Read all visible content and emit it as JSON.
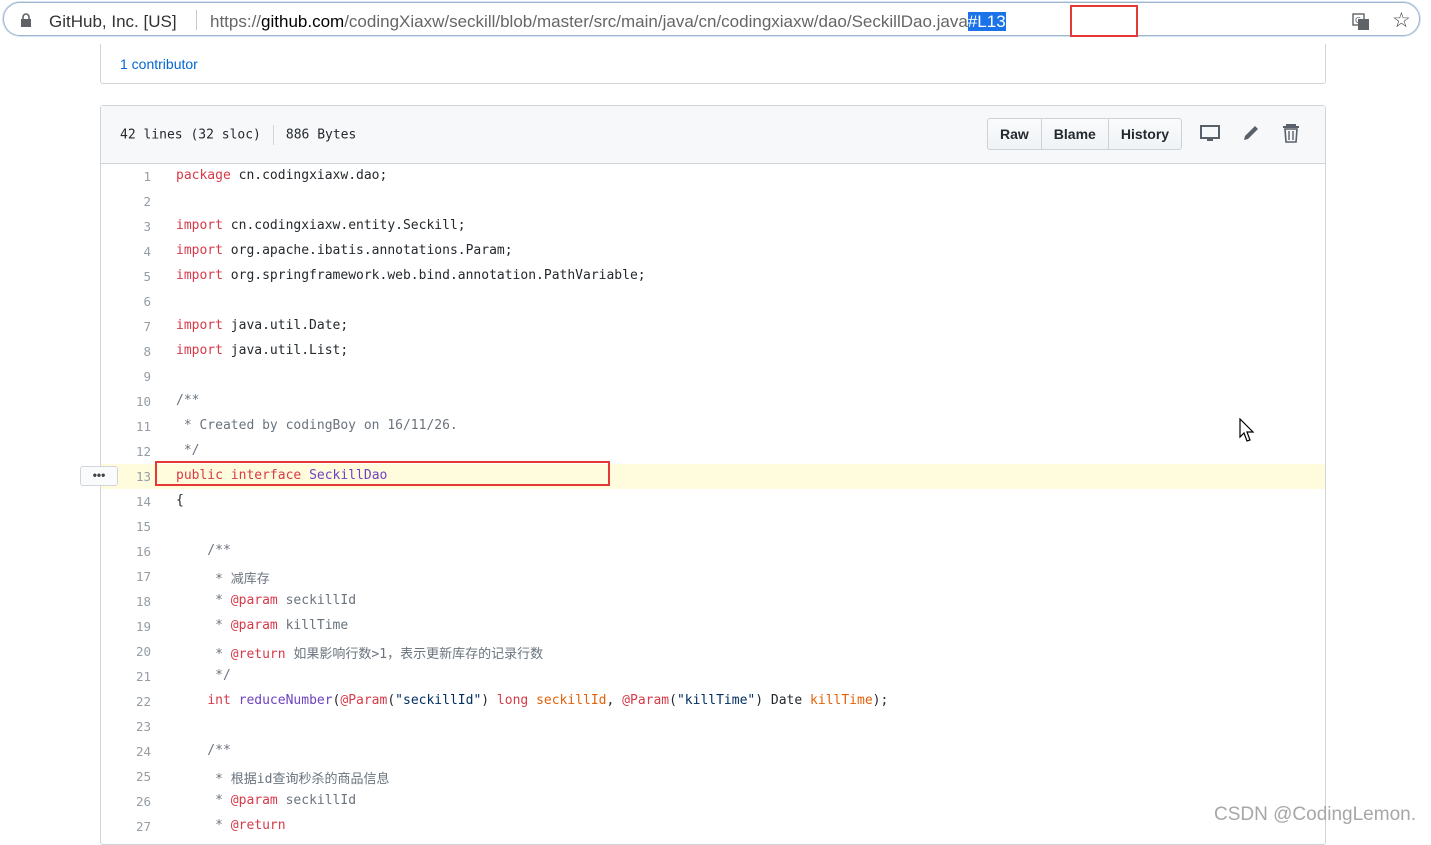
{
  "address_bar": {
    "site_identity": "GitHub, Inc. [US]",
    "url_prefix": "https://",
    "url_host": "github.com",
    "url_path": "/codingXiaxw/seckill/blob/master/src/main/java/cn/codingxiaxw/dao/SeckillDao.java",
    "url_hash": "#L13",
    "lock_icon": "lock-icon",
    "translate_icon": "translate-icon",
    "bookmark_icon": "star-icon"
  },
  "contributors": {
    "link": "1 contributor"
  },
  "file_header": {
    "lines_info": "42 lines (32 sloc)",
    "size": "886 Bytes",
    "buttons": {
      "raw": "Raw",
      "blame": "Blame",
      "history": "History"
    },
    "icons": [
      "desktop-icon",
      "pencil-icon",
      "trash-icon"
    ]
  },
  "highlighted_line": 13,
  "code_lines": [
    {
      "n": "1",
      "tokens": [
        {
          "t": "package",
          "c": "k"
        },
        {
          "t": " cn.codingxiaxw.dao;",
          "c": ""
        }
      ]
    },
    {
      "n": "2",
      "tokens": []
    },
    {
      "n": "3",
      "tokens": [
        {
          "t": "import",
          "c": "k"
        },
        {
          "t": " cn.codingxiaxw.entity.Seckill;",
          "c": ""
        }
      ]
    },
    {
      "n": "4",
      "tokens": [
        {
          "t": "import",
          "c": "k"
        },
        {
          "t": " org.apache.ibatis.annotations.Param;",
          "c": ""
        }
      ]
    },
    {
      "n": "5",
      "tokens": [
        {
          "t": "import",
          "c": "k"
        },
        {
          "t": " org.springframework.web.bind.annotation.PathVariable;",
          "c": ""
        }
      ]
    },
    {
      "n": "6",
      "tokens": []
    },
    {
      "n": "7",
      "tokens": [
        {
          "t": "import",
          "c": "k"
        },
        {
          "t": " java.util.Date;",
          "c": ""
        }
      ]
    },
    {
      "n": "8",
      "tokens": [
        {
          "t": "import",
          "c": "k"
        },
        {
          "t": " java.util.List;",
          "c": ""
        }
      ]
    },
    {
      "n": "9",
      "tokens": []
    },
    {
      "n": "10",
      "tokens": [
        {
          "t": "/**",
          "c": "c"
        }
      ]
    },
    {
      "n": "11",
      "tokens": [
        {
          "t": " * Created by codingBoy on 16/11/26.",
          "c": "c"
        }
      ]
    },
    {
      "n": "12",
      "tokens": [
        {
          "t": " */",
          "c": "c"
        }
      ]
    },
    {
      "n": "13",
      "tokens": [
        {
          "t": "public",
          "c": "k"
        },
        {
          "t": " ",
          "c": ""
        },
        {
          "t": "interface",
          "c": "k"
        },
        {
          "t": " ",
          "c": ""
        },
        {
          "t": "SeckillDao",
          "c": "e"
        }
      ]
    },
    {
      "n": "14",
      "tokens": [
        {
          "t": "{",
          "c": ""
        }
      ]
    },
    {
      "n": "15",
      "tokens": []
    },
    {
      "n": "16",
      "tokens": [
        {
          "t": "    /**",
          "c": "c"
        }
      ]
    },
    {
      "n": "17",
      "tokens": [
        {
          "t": "     * 减库存",
          "c": "c"
        }
      ]
    },
    {
      "n": "18",
      "tokens": [
        {
          "t": "     * ",
          "c": "c"
        },
        {
          "t": "@param",
          "c": "k"
        },
        {
          "t": " seckillId",
          "c": "c"
        }
      ]
    },
    {
      "n": "19",
      "tokens": [
        {
          "t": "     * ",
          "c": "c"
        },
        {
          "t": "@param",
          "c": "k"
        },
        {
          "t": " killTime",
          "c": "c"
        }
      ]
    },
    {
      "n": "20",
      "tokens": [
        {
          "t": "     * ",
          "c": "c"
        },
        {
          "t": "@return",
          "c": "k"
        },
        {
          "t": " 如果影响行数>1，表示更新库存的记录行数",
          "c": "c"
        }
      ]
    },
    {
      "n": "21",
      "tokens": [
        {
          "t": "     */",
          "c": "c"
        }
      ]
    },
    {
      "n": "22",
      "tokens": [
        {
          "t": "    ",
          "c": ""
        },
        {
          "t": "int",
          "c": "k"
        },
        {
          "t": " ",
          "c": ""
        },
        {
          "t": "reduceNumber",
          "c": "e"
        },
        {
          "t": "(",
          "c": ""
        },
        {
          "t": "@Param",
          "c": "k"
        },
        {
          "t": "(",
          "c": ""
        },
        {
          "t": "\"seckillId\"",
          "c": "s"
        },
        {
          "t": ") ",
          "c": ""
        },
        {
          "t": "long",
          "c": "k"
        },
        {
          "t": " ",
          "c": ""
        },
        {
          "t": "seckillId",
          "c": "v"
        },
        {
          "t": ", ",
          "c": ""
        },
        {
          "t": "@Param",
          "c": "k"
        },
        {
          "t": "(",
          "c": ""
        },
        {
          "t": "\"killTime\"",
          "c": "s"
        },
        {
          "t": ") Date ",
          "c": ""
        },
        {
          "t": "killTime",
          "c": "v"
        },
        {
          "t": ");",
          "c": ""
        }
      ]
    },
    {
      "n": "23",
      "tokens": []
    },
    {
      "n": "24",
      "tokens": [
        {
          "t": "    /**",
          "c": "c"
        }
      ]
    },
    {
      "n": "25",
      "tokens": [
        {
          "t": "     * 根据id查询秒杀的商品信息",
          "c": "c"
        }
      ]
    },
    {
      "n": "26",
      "tokens": [
        {
          "t": "     * ",
          "c": "c"
        },
        {
          "t": "@param",
          "c": "k"
        },
        {
          "t": " seckillId",
          "c": "c"
        }
      ]
    },
    {
      "n": "27",
      "tokens": [
        {
          "t": "     * ",
          "c": "c"
        },
        {
          "t": "@return",
          "c": "k"
        }
      ]
    }
  ],
  "line_actions_label": "•••",
  "watermark": "CSDN @CodingLemon."
}
